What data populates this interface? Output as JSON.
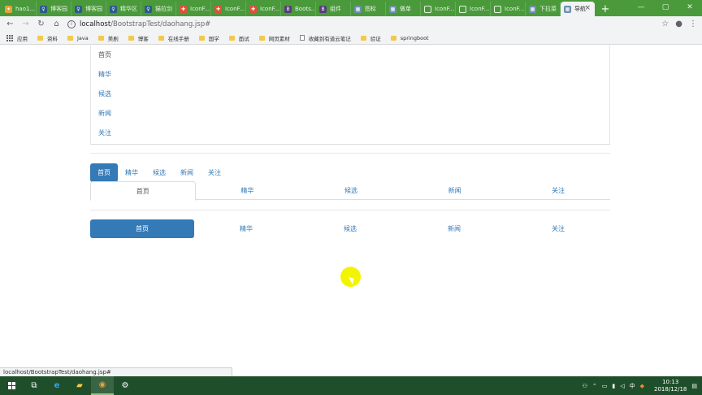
{
  "browser": {
    "tabs": [
      {
        "title": "hao1...",
        "icon": "leaf-icon"
      },
      {
        "title": "博客园",
        "icon": "blog-icon"
      },
      {
        "title": "博客园",
        "icon": "blog-icon"
      },
      {
        "title": "精华区",
        "icon": "blog-icon"
      },
      {
        "title": "猫拉剑",
        "icon": "blog-icon"
      },
      {
        "title": "IconF...",
        "icon": "iconfont-icon"
      },
      {
        "title": "IconF...",
        "icon": "iconfont-icon"
      },
      {
        "title": "IconF...",
        "icon": "iconfont-icon"
      },
      {
        "title": "Boots...",
        "icon": "bootstrap-icon"
      },
      {
        "title": "组件",
        "icon": "bootstrap-icon"
      },
      {
        "title": "图标",
        "icon": "image-icon"
      },
      {
        "title": "做单",
        "icon": "image-icon"
      },
      {
        "title": "IconF...",
        "icon": "doc-icon"
      },
      {
        "title": "IconF...",
        "icon": "doc-icon"
      },
      {
        "title": "IconF...",
        "icon": "doc-icon"
      },
      {
        "title": "下拉菜",
        "icon": "image-icon"
      },
      {
        "title": "导航",
        "icon": "image-icon"
      }
    ],
    "active_tab_index": 16,
    "url_host": "localhost",
    "url_path": "/BootstrapTest/daohang.jsp#"
  },
  "bookmarks": [
    {
      "label": "应用",
      "type": "apps"
    },
    {
      "label": "资料",
      "type": "folder"
    },
    {
      "label": "Java",
      "type": "folder"
    },
    {
      "label": "美剧",
      "type": "folder"
    },
    {
      "label": "博客",
      "type": "folder"
    },
    {
      "label": "在线手册",
      "type": "folder"
    },
    {
      "label": "国学",
      "type": "folder"
    },
    {
      "label": "面试",
      "type": "folder"
    },
    {
      "label": "网页素材",
      "type": "folder"
    },
    {
      "label": "收藏到有道云笔记",
      "type": "doc"
    },
    {
      "label": "验证",
      "type": "folder"
    },
    {
      "label": "springboot",
      "type": "folder"
    }
  ],
  "nav": {
    "items": [
      "首页",
      "精华",
      "候选",
      "新闻",
      "关注"
    ],
    "active_index": 0
  },
  "status_url": "localhost/BootstrapTest/daohang.jsp#",
  "taskbar": {
    "time": "10:13",
    "date": "2018/12/18",
    "ime": "中"
  },
  "colors": {
    "primary": "#337ab7",
    "tabstrip": "#4a9a3c",
    "taskbar": "#1f4f2a"
  }
}
